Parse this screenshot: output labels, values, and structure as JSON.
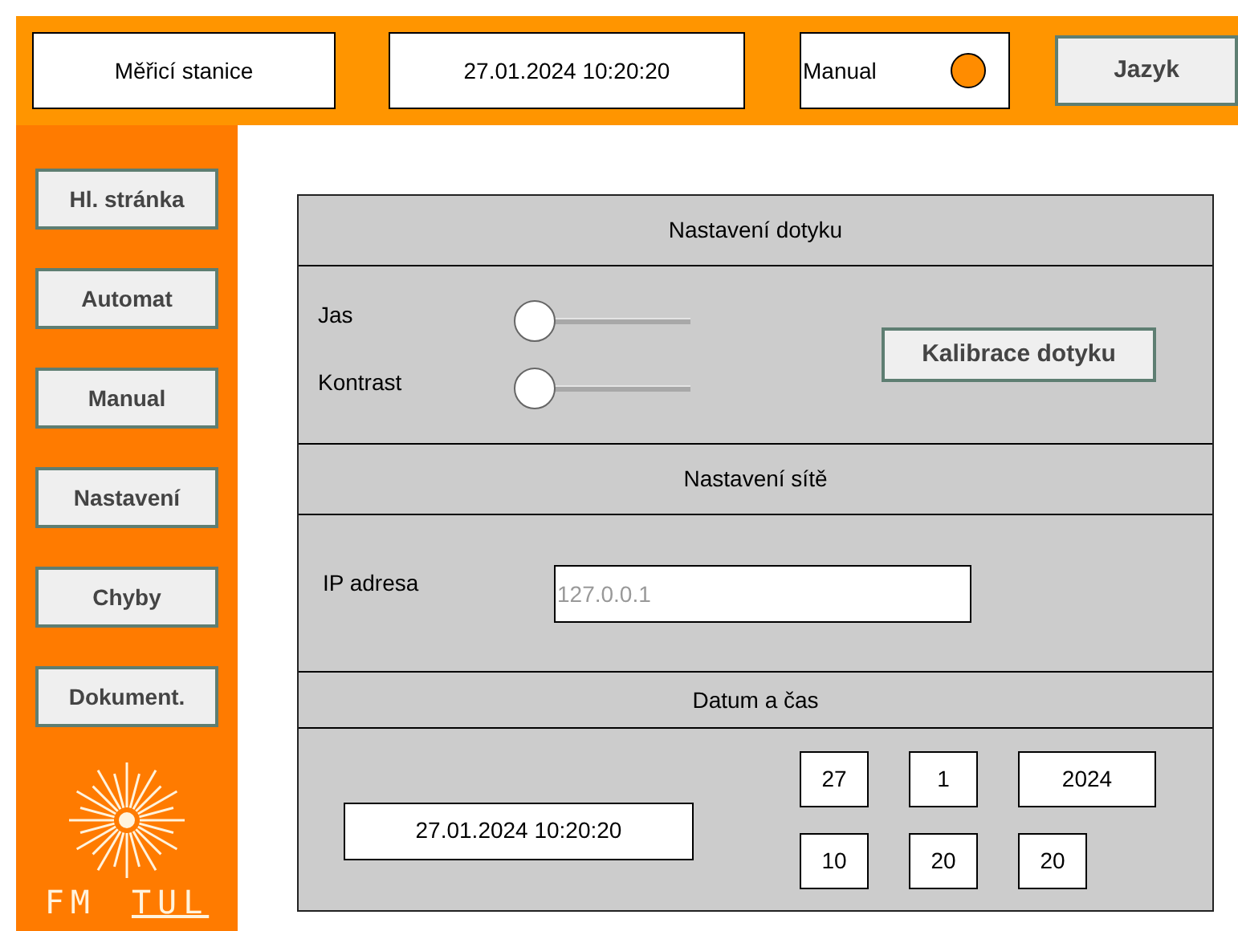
{
  "header": {
    "station": "Měřicí stanice",
    "datetime": "27.01.2024 10:20:20",
    "mode": {
      "label": "Manual",
      "on": true
    },
    "language_button": "Jazyk"
  },
  "sidebar": {
    "items": [
      "Hl. stránka",
      "Automat",
      "Manual",
      "Nastavení",
      "Chyby",
      "Dokument."
    ],
    "logo": {
      "left": "FM",
      "right": "TUL"
    }
  },
  "touch": {
    "title": "Nastavení dotyku",
    "sliders": [
      {
        "label": "Jas",
        "level": 0
      },
      {
        "label": "Kontrast",
        "level": 0
      }
    ],
    "calibrate_button": "Kalibrace dotyku"
  },
  "network": {
    "title": "Nastavení sítě",
    "ip_label": "IP adresa",
    "ip_placeholder": "127.0.0.1"
  },
  "datetime": {
    "title": "Datum a čas",
    "value": "27.01.2024 10:20:20",
    "date_fields": [
      "27",
      "1",
      "2024"
    ],
    "time_fields": [
      "10",
      "20",
      "20"
    ]
  }
}
